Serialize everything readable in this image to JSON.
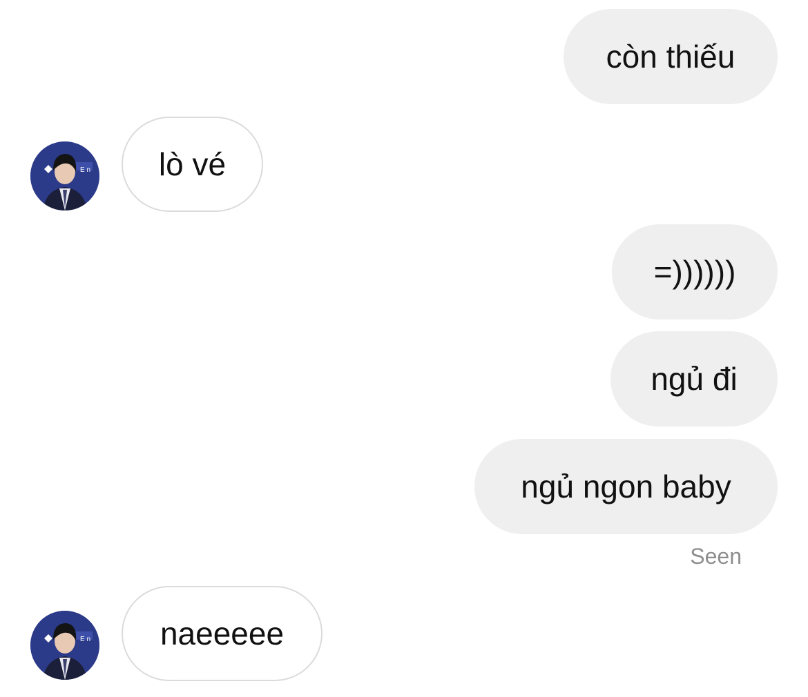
{
  "thread": {
    "messages": [
      {
        "id": "m1",
        "sender": "me",
        "text": "còn thiếu"
      },
      {
        "id": "m2",
        "sender": "them",
        "text": "lò vé"
      },
      {
        "id": "m3",
        "sender": "me",
        "text": "=))))))"
      },
      {
        "id": "m4",
        "sender": "me",
        "text": "ngủ đi"
      },
      {
        "id": "m5",
        "sender": "me",
        "text": "ngủ ngon baby"
      },
      {
        "id": "m6",
        "sender": "them",
        "text": "naeeeee"
      }
    ],
    "seen_label": "Seen"
  },
  "colors": {
    "outgoing_bubble": "#efefef",
    "incoming_border": "#dbdbdb",
    "text": "#111111",
    "seen_text": "#8e8e8e"
  },
  "icons": {
    "avatar": "contact-avatar"
  }
}
